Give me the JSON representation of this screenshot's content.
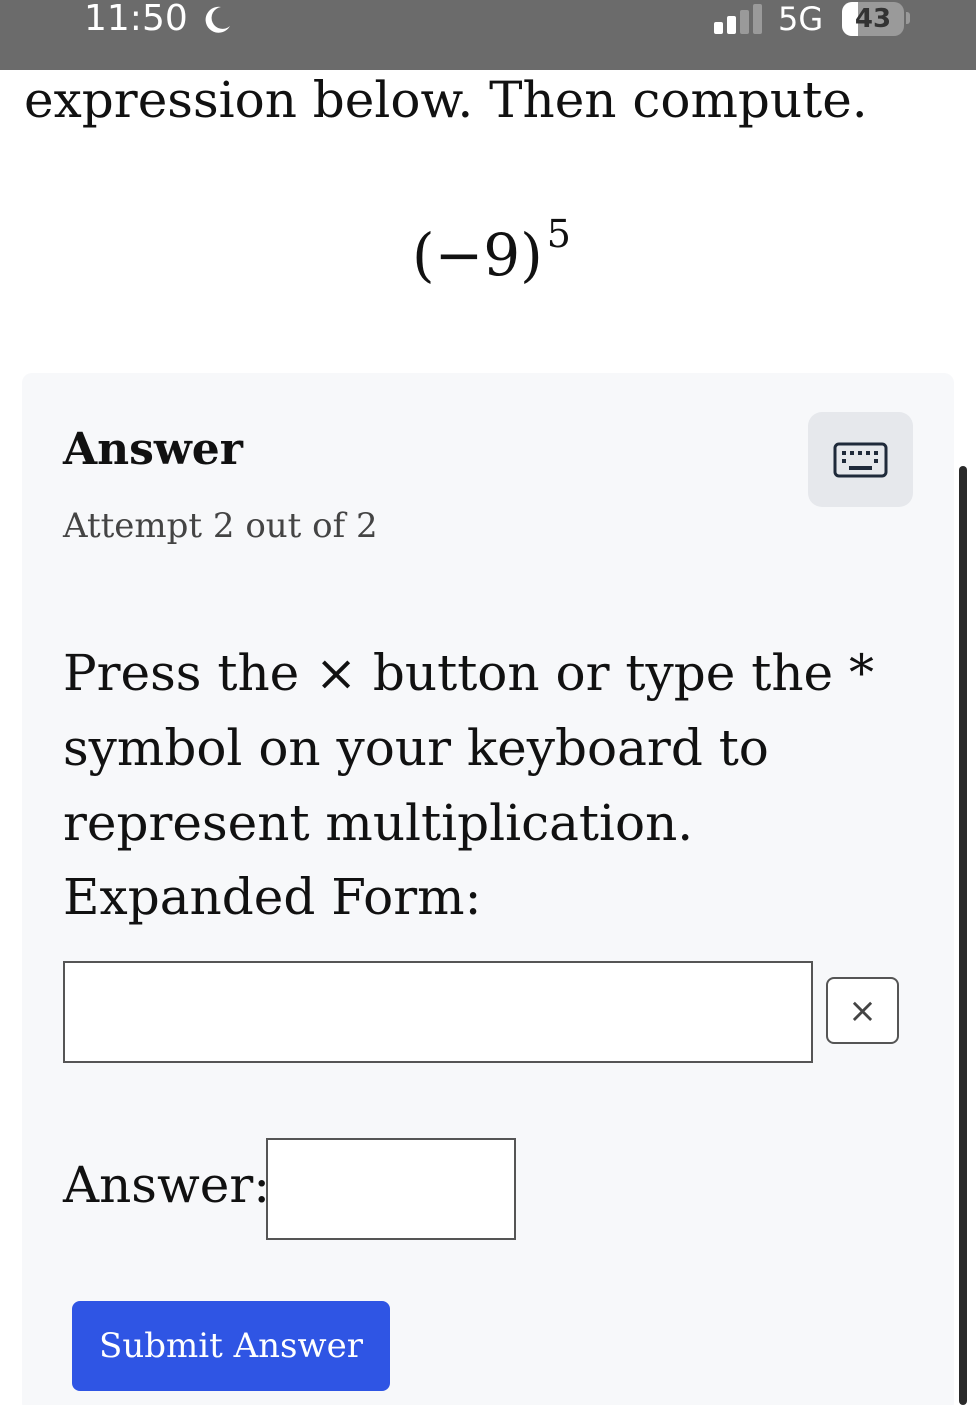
{
  "status_bar": {
    "time": "11:50",
    "network": "5G",
    "battery": "43",
    "battery_level_percent": 43
  },
  "question": {
    "heading_fragment": "expression below. Then compute.",
    "expression_base": "(−9)",
    "expression_exponent": "5"
  },
  "answer_panel": {
    "title": "Answer",
    "attempt_text": "Attempt 2 out of 2",
    "keyboard_icon": "keyboard-icon",
    "instruction_lines": [
      "Press the × button or type the *",
      "symbol on your keyboard to",
      "represent multiplication."
    ],
    "expanded_form_label": "Expanded Form:",
    "expanded_form_value": "",
    "times_button_label": "×",
    "answer_label": "Answer:",
    "answer_value": "",
    "submit_label": "Submit Answer"
  },
  "colors": {
    "status_bar": "#6b6b6b",
    "panel_bg": "#f7f8fa",
    "submit_button": "#2f55e4"
  }
}
